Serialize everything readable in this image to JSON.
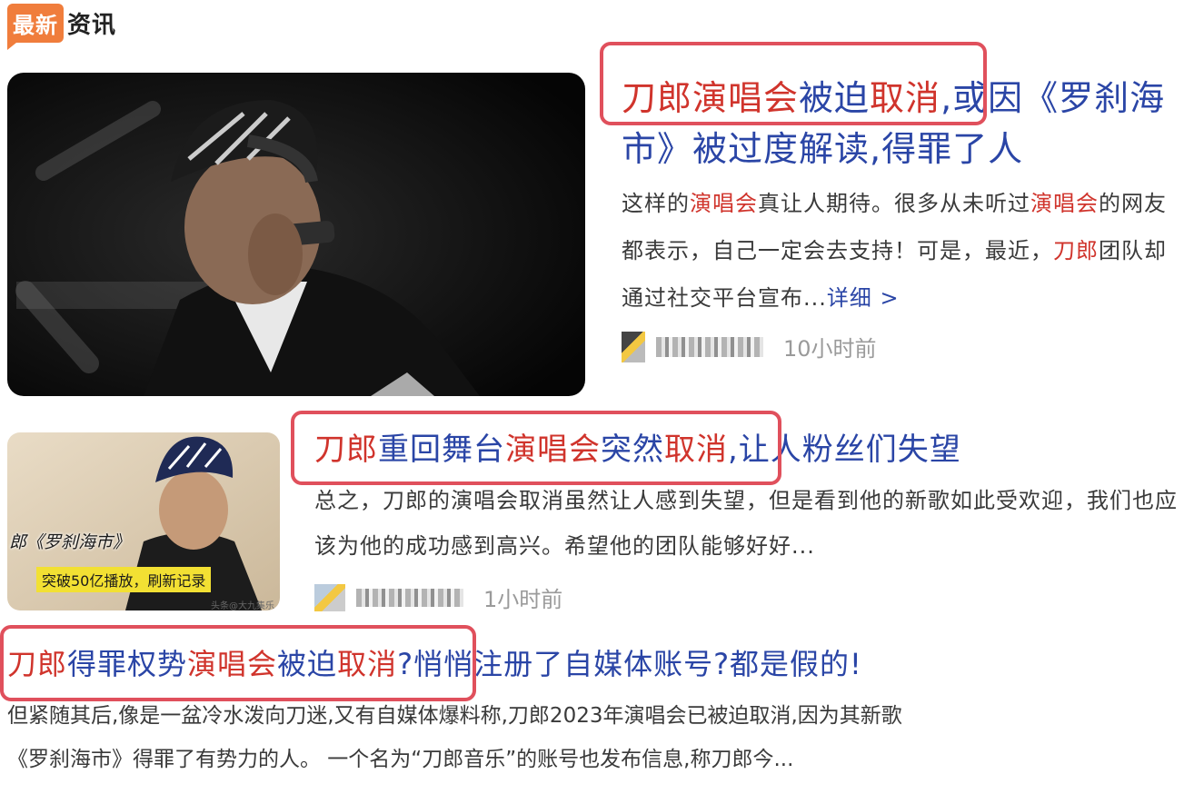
{
  "header": {
    "badge": "最新",
    "text": "资讯"
  },
  "articles": [
    {
      "title_parts": [
        {
          "text": "刀郎",
          "hl": true
        },
        {
          "text": "演唱会",
          "hl": true
        },
        {
          "text": "被迫",
          "hl": false
        },
        {
          "text": "取消",
          "hl": true
        },
        {
          "text": ",或因《罗刹海市》被过度解读,得罪了人",
          "hl": false
        }
      ],
      "desc_parts": [
        {
          "text": "这样的",
          "hl": false
        },
        {
          "text": "演唱会",
          "hl": true
        },
        {
          "text": "真让人期待。很多从未听过",
          "hl": false
        },
        {
          "text": "演唱会",
          "hl": true
        },
        {
          "text": "的网友都表示，自己一定会去支持！可是，最近，",
          "hl": false
        },
        {
          "text": "刀郎",
          "hl": true
        },
        {
          "text": "团队却通过社交平台宣布...",
          "hl": false
        }
      ],
      "more": "详细 >",
      "time": "10小时前"
    },
    {
      "title_parts": [
        {
          "text": "刀郎",
          "hl": true
        },
        {
          "text": "重回舞台",
          "hl": false
        },
        {
          "text": "演唱会",
          "hl": true
        },
        {
          "text": "突然",
          "hl": false
        },
        {
          "text": "取消",
          "hl": true
        },
        {
          "text": ",让人粉丝们失望",
          "hl": false
        }
      ],
      "desc": "总之，刀郎的演唱会取消虽然让人感到失望，但是看到他的新歌如此受欢迎，我们也应该为他的成功感到高兴。希望他的团队能够好好...",
      "caption1": "郎《罗刹海市》",
      "caption2": "突破50亿播放，刷新记录",
      "watermark": "头条@大九集乐",
      "time": "1小时前"
    },
    {
      "title_parts": [
        {
          "text": "刀郎",
          "hl": true
        },
        {
          "text": "得罪权势",
          "hl": false
        },
        {
          "text": "演唱会",
          "hl": true
        },
        {
          "text": "被迫",
          "hl": false
        },
        {
          "text": "取消",
          "hl": true
        },
        {
          "text": "?悄悄注册了自媒体账号?都是假的!",
          "hl": false
        }
      ],
      "desc_line1": "但紧随其后,像是一盆冷水泼向刀迷,又有自媒体爆料称,刀郎2023年演唱会已被迫取消,因为其新歌",
      "desc_line2": "《罗刹海市》得罪了有势力的人。 一个名为“刀郎音乐”的账号也发布信息,称刀郎今..."
    }
  ],
  "colors": {
    "link": "#2a45a6",
    "highlight": "#d0342c",
    "annotation_box": "#e0505c",
    "badge": "#f07d3c"
  }
}
